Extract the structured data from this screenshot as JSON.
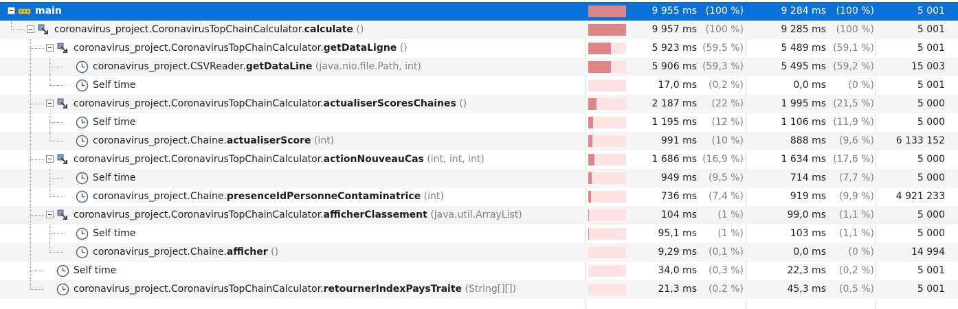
{
  "rows": [
    {
      "label": "main",
      "cls": "",
      "mth": "",
      "args": "",
      "icon": "thread-icon",
      "level": 0,
      "hasExp": true,
      "bar": 1.0,
      "time": "9 955 ms",
      "pct": "(100 %)",
      "own": "9 284 ms",
      "ownPct": "(100 %)",
      "inv": "5 001"
    },
    {
      "label": "",
      "cls": "coronavirus_project.CoronavirusTopChainCalculator.",
      "mth": "calculate",
      "args": " ()",
      "icon": "method-icon",
      "level": 1,
      "hasExp": true,
      "bar": 1.0,
      "time": "9 957 ms",
      "pct": "(100 %)",
      "own": "9 285 ms",
      "ownPct": "(100 %)",
      "inv": "5 001"
    },
    {
      "label": "",
      "cls": "coronavirus_project.CoronavirusTopChainCalculator.",
      "mth": "getDataLigne",
      "args": " ()",
      "icon": "method-icon",
      "level": 2,
      "hasExp": true,
      "bar": 0.595,
      "time": "5 923 ms",
      "pct": "(59,5 %)",
      "own": "5 489 ms",
      "ownPct": "(59,1 %)",
      "inv": "5 001"
    },
    {
      "label": "",
      "cls": "coronavirus_project.CSVReader.",
      "mth": "getDataLine",
      "args": " (java.nio.file.Path, int)",
      "icon": "clock-icon",
      "level": 3,
      "hasExp": false,
      "bar": 0.593,
      "time": "5 906 ms",
      "pct": "(59,3 %)",
      "own": "5 495 ms",
      "ownPct": "(59,2 %)",
      "inv": "15 003"
    },
    {
      "label": "Self time",
      "cls": "",
      "mth": "",
      "args": "",
      "icon": "clock-icon",
      "level": 3,
      "hasExp": false,
      "bar": 0.002,
      "time": "17,0 ms",
      "pct": "(0,2 %)",
      "own": "0,0 ms",
      "ownPct": "(0 %)",
      "inv": "5 001"
    },
    {
      "label": "",
      "cls": "coronavirus_project.CoronavirusTopChainCalculator.",
      "mth": "actualiserScoresChaines",
      "args": " ()",
      "icon": "method-icon",
      "level": 2,
      "hasExp": true,
      "bar": 0.22,
      "time": "2 187 ms",
      "pct": "(22 %)",
      "own": "1 995 ms",
      "ownPct": "(21,5 %)",
      "inv": "5 000"
    },
    {
      "label": "Self time",
      "cls": "",
      "mth": "",
      "args": "",
      "icon": "clock-icon",
      "level": 3,
      "hasExp": false,
      "bar": 0.12,
      "time": "1 195 ms",
      "pct": "(12 %)",
      "own": "1 106 ms",
      "ownPct": "(11,9 %)",
      "inv": "5 000"
    },
    {
      "label": "",
      "cls": "coronavirus_project.Chaine.",
      "mth": "actualiserScore",
      "args": " (int)",
      "icon": "clock-icon",
      "level": 3,
      "hasExp": false,
      "bar": 0.1,
      "time": "991 ms",
      "pct": "(10 %)",
      "own": "888 ms",
      "ownPct": "(9,6 %)",
      "inv": "6 133 152"
    },
    {
      "label": "",
      "cls": "coronavirus_project.CoronavirusTopChainCalculator.",
      "mth": "actionNouveauCas",
      "args": " (int, int, int)",
      "icon": "method-icon",
      "level": 2,
      "hasExp": true,
      "bar": 0.169,
      "time": "1 686 ms",
      "pct": "(16,9 %)",
      "own": "1 634 ms",
      "ownPct": "(17,6 %)",
      "inv": "5 000"
    },
    {
      "label": "Self time",
      "cls": "",
      "mth": "",
      "args": "",
      "icon": "clock-icon",
      "level": 3,
      "hasExp": false,
      "bar": 0.095,
      "time": "949 ms",
      "pct": "(9,5 %)",
      "own": "714 ms",
      "ownPct": "(7,7 %)",
      "inv": "5 000"
    },
    {
      "label": "",
      "cls": "coronavirus_project.Chaine.",
      "mth": "presenceIdPersonneContaminatrice",
      "args": " (int)",
      "icon": "clock-icon",
      "level": 3,
      "hasExp": false,
      "bar": 0.074,
      "time": "736 ms",
      "pct": "(7,4 %)",
      "own": "919 ms",
      "ownPct": "(9,9 %)",
      "inv": "4 921 233"
    },
    {
      "label": "",
      "cls": "coronavirus_project.CoronavirusTopChainCalculator.",
      "mth": "afficherClassement",
      "args": " (java.util.ArrayList)",
      "icon": "method-icon",
      "level": 2,
      "hasExp": true,
      "bar": 0.01,
      "time": "104 ms",
      "pct": "(1 %)",
      "own": "99,0 ms",
      "ownPct": "(1,1 %)",
      "inv": "5 000"
    },
    {
      "label": "Self time",
      "cls": "",
      "mth": "",
      "args": "",
      "icon": "clock-icon",
      "level": 3,
      "hasExp": false,
      "bar": 0.01,
      "time": "95,1 ms",
      "pct": "(1 %)",
      "own": "103 ms",
      "ownPct": "(1,1 %)",
      "inv": "5 000"
    },
    {
      "label": "",
      "cls": "coronavirus_project.Chaine.",
      "mth": "afficher",
      "args": " ()",
      "icon": "clock-icon",
      "level": 3,
      "hasExp": false,
      "bar": 0.001,
      "time": "9,29 ms",
      "pct": "(0,1 %)",
      "own": "0,0 ms",
      "ownPct": "(0 %)",
      "inv": "14 994"
    },
    {
      "label": "Self time",
      "cls": "",
      "mth": "",
      "args": "",
      "icon": "clock-icon",
      "level": 2,
      "hasExp": false,
      "bar": 0.003,
      "time": "34,0 ms",
      "pct": "(0,3 %)",
      "own": "22,3 ms",
      "ownPct": "(0,2 %)",
      "inv": "5 001"
    },
    {
      "label": "",
      "cls": "coronavirus_project.CoronavirusTopChainCalculator.",
      "mth": "retournerIndexPaysTraite",
      "args": " (String[][])",
      "icon": "clock-icon",
      "level": 2,
      "hasExp": false,
      "bar": 0.002,
      "time": "21,3 ms",
      "pct": "(0,2 %)",
      "own": "45,3 ms",
      "ownPct": "(0,5 %)",
      "inv": "5 001"
    }
  ]
}
